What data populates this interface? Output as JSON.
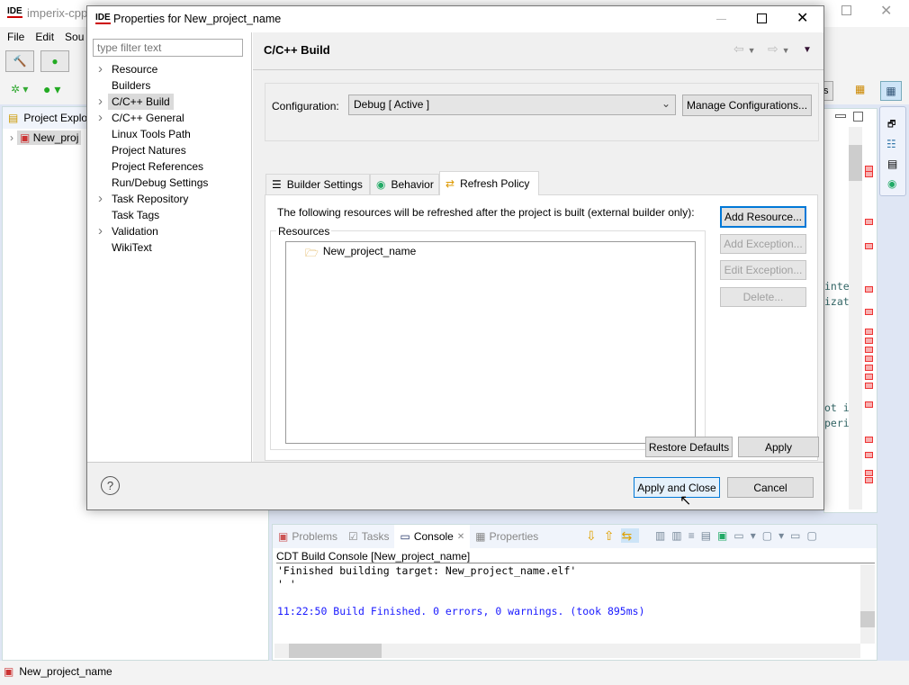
{
  "ide": {
    "title": "imperix-cpp",
    "menu": [
      "File",
      "Edit",
      "Sou"
    ],
    "explorer_title": "Project Explo",
    "project": "New_proj",
    "status_project": "New_project_name",
    "toolbar_partial": "ss"
  },
  "dialog": {
    "title": "Properties for New_project_name",
    "filter_placeholder": "type filter text",
    "tree": [
      {
        "label": "Resource",
        "expandable": true
      },
      {
        "label": "Builders",
        "expandable": false
      },
      {
        "label": "C/C++ Build",
        "expandable": true,
        "selected": true
      },
      {
        "label": "C/C++ General",
        "expandable": true
      },
      {
        "label": "Linux Tools Path",
        "expandable": false
      },
      {
        "label": "Project Natures",
        "expandable": false
      },
      {
        "label": "Project References",
        "expandable": false
      },
      {
        "label": "Run/Debug Settings",
        "expandable": false
      },
      {
        "label": "Task Repository",
        "expandable": true
      },
      {
        "label": "Task Tags",
        "expandable": false
      },
      {
        "label": "Validation",
        "expandable": true
      },
      {
        "label": "WikiText",
        "expandable": false
      }
    ],
    "page_title": "C/C++ Build",
    "config_label": "Configuration:",
    "config_value": "Debug  [ Active ]",
    "manage_button": "Manage Configurations...",
    "tabs": [
      {
        "label": "Builder Settings",
        "icon": "list-icon"
      },
      {
        "label": "Behavior",
        "icon": "radio-icon"
      },
      {
        "label": "Refresh Policy",
        "icon": "refresh-icon",
        "active": true
      }
    ],
    "description": "The following resources will be refreshed after the project is built (external builder only):",
    "resources_label": "Resources",
    "resources": [
      "New_project_name"
    ],
    "side_buttons": [
      {
        "label": "Add Resource...",
        "enabled": true
      },
      {
        "label": "Add Exception...",
        "enabled": false
      },
      {
        "label": "Edit Exception...",
        "enabled": false
      },
      {
        "label": "Delete...",
        "enabled": false
      }
    ],
    "restore_defaults": "Restore Defaults",
    "apply": "Apply",
    "apply_close": "Apply and Close",
    "cancel": "Cancel"
  },
  "editor": {
    "fragments": [
      "inter",
      "izati",
      "ot is",
      "peri"
    ]
  },
  "console": {
    "tabs": [
      "Problems",
      "Tasks",
      "Console",
      "Properties"
    ],
    "active_tab": "Console",
    "header": "CDT Build Console [New_project_name]",
    "lines": [
      "'Finished building target: New_project_name.elf'",
      "' '",
      ""
    ],
    "status_line": "11:22:50 Build Finished. 0 errors, 0 warnings. (took 895ms)",
    "status_color": "#1a1aff"
  }
}
